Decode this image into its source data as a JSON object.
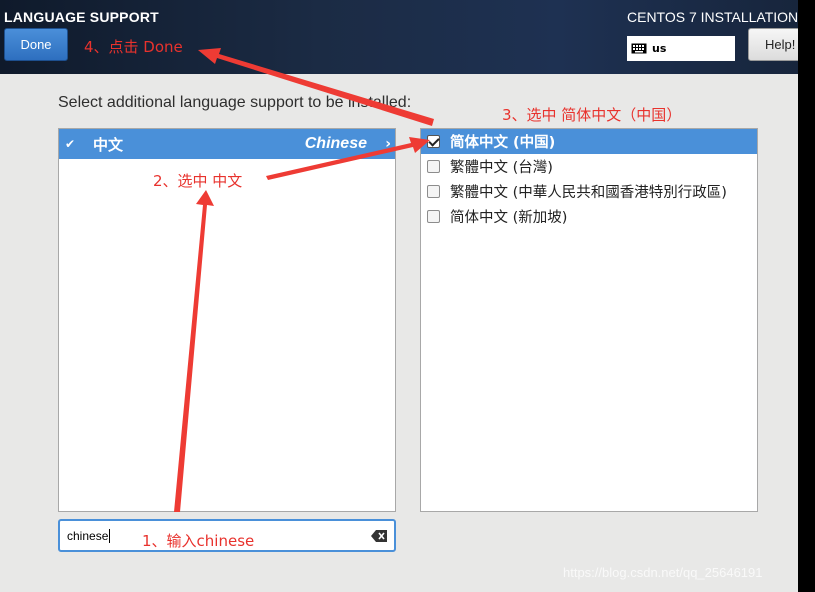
{
  "header": {
    "title": "LANGUAGE SUPPORT",
    "done_label": "Done",
    "install_title": "CENTOS 7 INSTALLATION",
    "keyboard_layout": "us",
    "help_label": "Help!"
  },
  "prompt": "Select additional language support to be installed:",
  "languages": [
    {
      "native": "中文",
      "english": "Chinese",
      "selected": true
    }
  ],
  "locales": [
    {
      "label": "简体中文 (中国)",
      "checked": true,
      "selected": true
    },
    {
      "label": "繁體中文 (台灣)",
      "checked": false,
      "selected": false
    },
    {
      "label": "繁體中文 (中華人民共和國香港特別行政區)",
      "checked": false,
      "selected": false
    },
    {
      "label": "简体中文 (新加坡)",
      "checked": false,
      "selected": false
    }
  ],
  "search": {
    "value": "chinese"
  },
  "annotations": {
    "step1": "1、输入chinese",
    "step2": "2、选中 中文",
    "step3": "3、选中 简体中文（中国）",
    "step4": "4、点击 Done"
  },
  "annotation_color": "#e8322d",
  "accent_color": "#4a90d9",
  "watermark": "https://blog.csdn.net/qq_25646191"
}
